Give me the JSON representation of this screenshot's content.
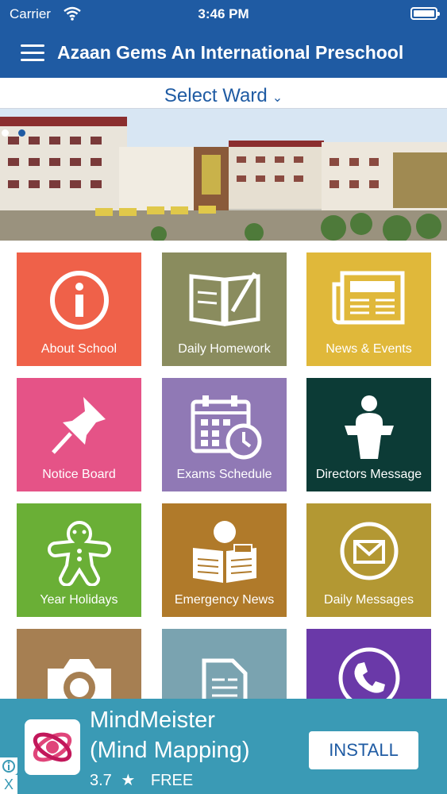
{
  "status": {
    "carrier": "Carrier",
    "time": "3:46 PM"
  },
  "nav": {
    "title": "Azaan Gems An International Preschool"
  },
  "ward": {
    "label": "Select Ward"
  },
  "banner": {
    "slide_count": 2,
    "active_slide": 2
  },
  "tiles": [
    {
      "label": "About School",
      "color": "#ef6149",
      "icon": "info-icon"
    },
    {
      "label": "Daily Homework",
      "color": "#8a8c5e",
      "icon": "book-icon"
    },
    {
      "label": "News & Events",
      "color": "#e0b83a",
      "icon": "newspaper-icon"
    },
    {
      "label": "Notice Board",
      "color": "#e55387",
      "icon": "pin-icon"
    },
    {
      "label": "Exams Schedule",
      "color": "#9079b5",
      "icon": "calendar-clock-icon"
    },
    {
      "label": "Directors Message",
      "color": "#0c3b36",
      "icon": "podium-icon"
    },
    {
      "label": "Year Holidays",
      "color": "#6aaf36",
      "icon": "gingerbread-icon"
    },
    {
      "label": "Emergency News",
      "color": "#b07a2a",
      "icon": "reader-icon"
    },
    {
      "label": "Daily Messages",
      "color": "#b39833",
      "icon": "mail-icon"
    },
    {
      "label": "",
      "color": "#a67f52",
      "icon": "camera-icon"
    },
    {
      "label": "",
      "color": "#7aa3b0",
      "icon": "document-icon"
    },
    {
      "label": "",
      "color": "#6a39a8",
      "icon": "phone-icon"
    }
  ],
  "ad": {
    "app_name_line1": "MindMeister",
    "app_name_line2": "(Mind Mapping)",
    "rating": "3.7",
    "price": "FREE",
    "install_label": "INSTALL",
    "close_glyph": "X"
  }
}
